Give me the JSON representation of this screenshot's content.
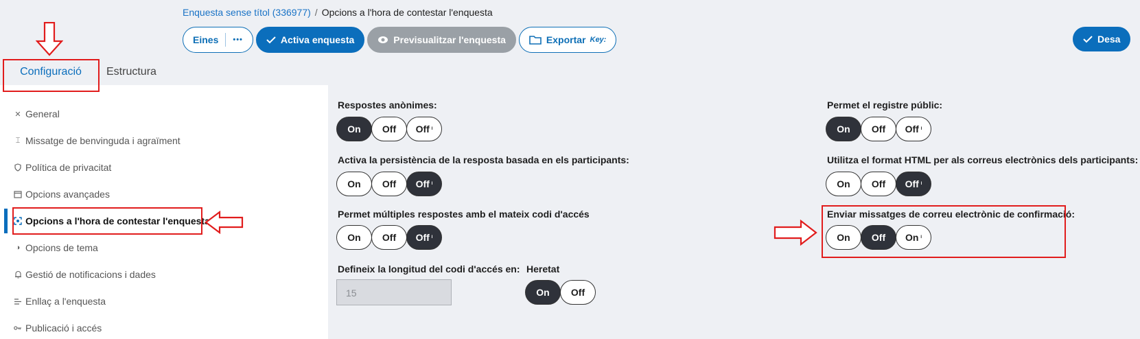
{
  "breadcrumb": {
    "survey": "Enquesta sense títol (336977)",
    "separator": "/",
    "current": "Opcions a l'hora de contestar l'enquesta"
  },
  "toolbar": {
    "tools_label": "Eines",
    "more_label": "•••",
    "activate_label": "Activa enquesta",
    "preview_label": "Previsualitzar l'enquesta",
    "export_label": "Exportar",
    "export_key": "Key:",
    "save_label": "Desa"
  },
  "tabs": {
    "config": "Configuració",
    "structure": "Estructura"
  },
  "sidebar": {
    "items": [
      {
        "label": "General",
        "icon": "tools-icon"
      },
      {
        "label": "Missatge de benvinguda i agraïment",
        "icon": "text-icon"
      },
      {
        "label": "Política de privacitat",
        "icon": "shield-icon"
      },
      {
        "label": "Opcions avançades",
        "icon": "window-icon"
      },
      {
        "label": "Opcions a l'hora de contestar l'enquesta",
        "icon": "focus-icon"
      },
      {
        "label": "Opcions de tema",
        "icon": "contrast-icon"
      },
      {
        "label": "Gestió de notificacions i dades",
        "icon": "bell-icon"
      },
      {
        "label": "Enllaç a l'enquesta",
        "icon": "list-icon"
      },
      {
        "label": "Publicació i accés",
        "icon": "key-icon"
      }
    ]
  },
  "settings": {
    "anon": {
      "label": "Respostes anònimes:",
      "opts": [
        "On",
        "Off",
        "Off"
      ],
      "selected": "On"
    },
    "persist": {
      "label": "Activa la persistència de la resposta basada en els participants:",
      "opts": [
        "On",
        "Off",
        "Off"
      ],
      "selected": "Off (inherited)"
    },
    "multi": {
      "label": "Permet múltiples respostes amb el mateix codi d'accés",
      "opts": [
        "On",
        "Off",
        "Off"
      ],
      "selected": "Off (inherited)"
    },
    "length_label": "Defineix la longitud del codi d'accés en:",
    "length_value": "15",
    "inherit": {
      "label": "Heretat",
      "opts": [
        "On",
        "Off"
      ],
      "selected": "On"
    },
    "public_reg": {
      "label": "Permet el registre públic:",
      "opts": [
        "On",
        "Off",
        "Off"
      ],
      "selected": "On"
    },
    "html_email": {
      "label": "Utilitza el format HTML per als correus electrònics dels participants:",
      "opts": [
        "On",
        "Off",
        "Off"
      ],
      "selected": "Off (inherited)"
    },
    "confirm_email": {
      "label": "Enviar missatges de correu electrònic de confirmació:",
      "opts": [
        "On",
        "Off",
        "On"
      ],
      "selected": "Off"
    },
    "inherit_mark": "ᴵ"
  },
  "colors": {
    "accent": "#0b6ebc",
    "selected": "#2f323a",
    "annotation": "#e11c1c"
  }
}
